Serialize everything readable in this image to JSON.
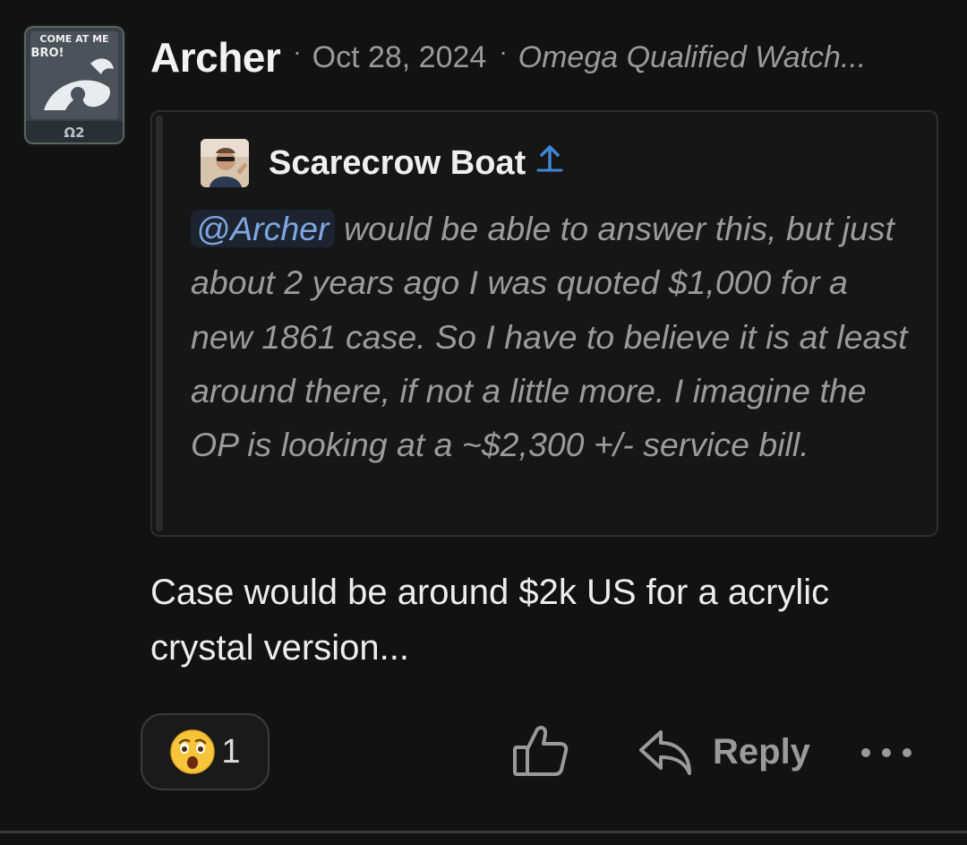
{
  "post": {
    "author": {
      "name": "Archer",
      "avatar_text_top": "COME AT ME",
      "avatar_text_mid": "BRO!",
      "avatar_badge": "Ω2"
    },
    "separator": "·",
    "date": "Oct 28, 2024",
    "user_title": "Omega Qualified Watch...",
    "quote": {
      "author": "Scarecrow Boat",
      "icon": "go-to-quoted-post-icon",
      "mention": "@Archer",
      "text": " would be able to answer this, but just about 2 years ago I was quoted $1,000 for a new 1861 case. So I have to believe it is at least around there, if not a little more. I imagine the OP is looking at a ~$2,300 +/- service bill."
    },
    "body_text": "Case would be around $2k US for a acrylic crystal version..."
  },
  "actions": {
    "reaction": {
      "emoji": "astonished-face-icon",
      "count": "1"
    },
    "like_icon": "thumbs-up-icon",
    "reply_icon": "reply-arrow-icon",
    "reply_label": "Reply",
    "more_icon": "more-options-icon"
  },
  "colors": {
    "background": "#121212",
    "mention": "#7ea7df",
    "goto_icon": "#3f86d6",
    "muted_text": "#9a9a9a"
  }
}
